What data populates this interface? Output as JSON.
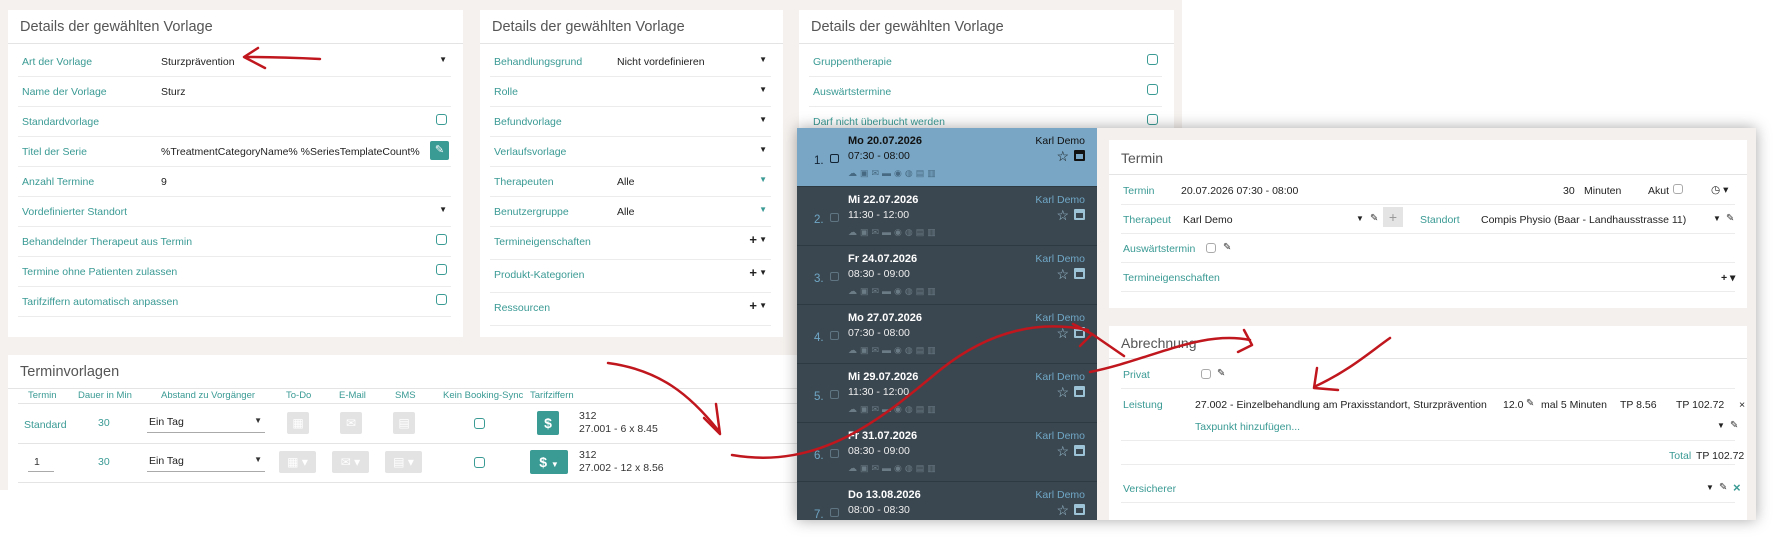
{
  "panel1": {
    "title": "Details der gewählten Vorlage",
    "rows": [
      {
        "label": "Art der Vorlage",
        "value": "Sturzprävention"
      },
      {
        "label": "Name der Vorlage",
        "value": "Sturz"
      },
      {
        "label": "Standardvorlage",
        "value": ""
      },
      {
        "label": "Titel der Serie",
        "value": "%TreatmentCategoryName% %SeriesTemplateCount%"
      },
      {
        "label": "Anzahl Termine",
        "value": "9"
      },
      {
        "label": "Vordefinierter Standort",
        "value": ""
      },
      {
        "label": "Behandelnder Therapeut aus Termin",
        "value": ""
      },
      {
        "label": "Termine ohne Patienten zulassen",
        "value": ""
      },
      {
        "label": "Tarifziffern automatisch anpassen",
        "value": ""
      }
    ]
  },
  "panel2": {
    "title": "Details der gewählten Vorlage",
    "rows": [
      {
        "label": "Behandlungsgrund",
        "value": "Nicht vordefinieren"
      },
      {
        "label": "Rolle",
        "value": ""
      },
      {
        "label": "Befundvorlage",
        "value": ""
      },
      {
        "label": "Verlaufsvorlage",
        "value": ""
      },
      {
        "label": "Therapeuten",
        "value": "Alle"
      },
      {
        "label": "Benutzergruppe",
        "value": "Alle"
      },
      {
        "label": "Termineigenschaften",
        "value": ""
      },
      {
        "label": "Produkt-Kategorien",
        "value": ""
      },
      {
        "label": "Ressourcen",
        "value": ""
      }
    ]
  },
  "panel3": {
    "title": "Details der gewählten Vorlage",
    "rows": [
      {
        "label": "Gruppentherapie"
      },
      {
        "label": "Auswärtstermine"
      },
      {
        "label": "Darf nicht überbucht werden"
      }
    ]
  },
  "terminvorlagen": {
    "title": "Terminvorlagen",
    "headers": [
      "Termin",
      "Dauer in Min",
      "Abstand zu Vorgänger",
      "To-Do",
      "E-Mail",
      "SMS",
      "Kein Booking-Sync",
      "Tarifziffern"
    ],
    "rows": [
      {
        "termin": "Standard",
        "dauer": "30",
        "abstand": "Ein Tag",
        "tarif_code": "312",
        "tarif_detail": "27.001 - 6 x 8.45"
      },
      {
        "termin": "1",
        "dauer": "30",
        "abstand": "Ein Tag",
        "tarif_code": "312",
        "tarif_detail": "27.002 - 12 x 8.56"
      }
    ]
  },
  "appointments": [
    {
      "num": "1.",
      "date": "Mo 20.07.2026",
      "time": "07:30 - 08:00",
      "who": "Karl Demo",
      "active": true
    },
    {
      "num": "2.",
      "date": "Mi 22.07.2026",
      "time": "11:30 - 12:00",
      "who": "Karl Demo"
    },
    {
      "num": "3.",
      "date": "Fr 24.07.2026",
      "time": "08:30 - 09:00",
      "who": "Karl Demo"
    },
    {
      "num": "4.",
      "date": "Mo 27.07.2026",
      "time": "07:30 - 08:00",
      "who": "Karl Demo"
    },
    {
      "num": "5.",
      "date": "Mi 29.07.2026",
      "time": "11:30 - 12:00",
      "who": "Karl Demo"
    },
    {
      "num": "6.",
      "date": "Fr 31.07.2026",
      "time": "08:30 - 09:00",
      "who": "Karl Demo"
    },
    {
      "num": "7.",
      "date": "Do 13.08.2026",
      "time": "08:00 - 08:30",
      "who": "Karl Demo"
    }
  ],
  "termin": {
    "title": "Termin",
    "termin_label": "Termin",
    "termin_value": "20.07.2026 07:30 - 08:00",
    "duration": "30",
    "duration_unit": "Minuten",
    "akut_label": "Akut",
    "therapeut_label": "Therapeut",
    "therapeut_value": "Karl Demo",
    "standort_label": "Standort",
    "standort_value": "Compis Physio (Baar - Landhausstrasse 11)",
    "auswaerts_label": "Auswärtstermin",
    "eigenschaften_label": "Termineigenschaften"
  },
  "abrechnung": {
    "title": "Abrechnung",
    "privat_label": "Privat",
    "leistung_label": "Leistung",
    "leistung_value": "27.002 - Einzelbehandlung am Praxisstandort, Sturzprävention",
    "quantity": "12.0",
    "per_text": "mal 5 Minuten",
    "tp": "TP 8.56",
    "tp_total_row": "TP 102.72",
    "add_tax": "Taxpunkt hinzufügen...",
    "total_label": "Total",
    "total_value": "TP 102.72",
    "versicherer_label": "Versicherer"
  },
  "colors": {
    "accent": "#3a9a94",
    "annotation": "#c0161d",
    "list_bg": "#3b4750",
    "active_bg": "#79a6c4"
  }
}
